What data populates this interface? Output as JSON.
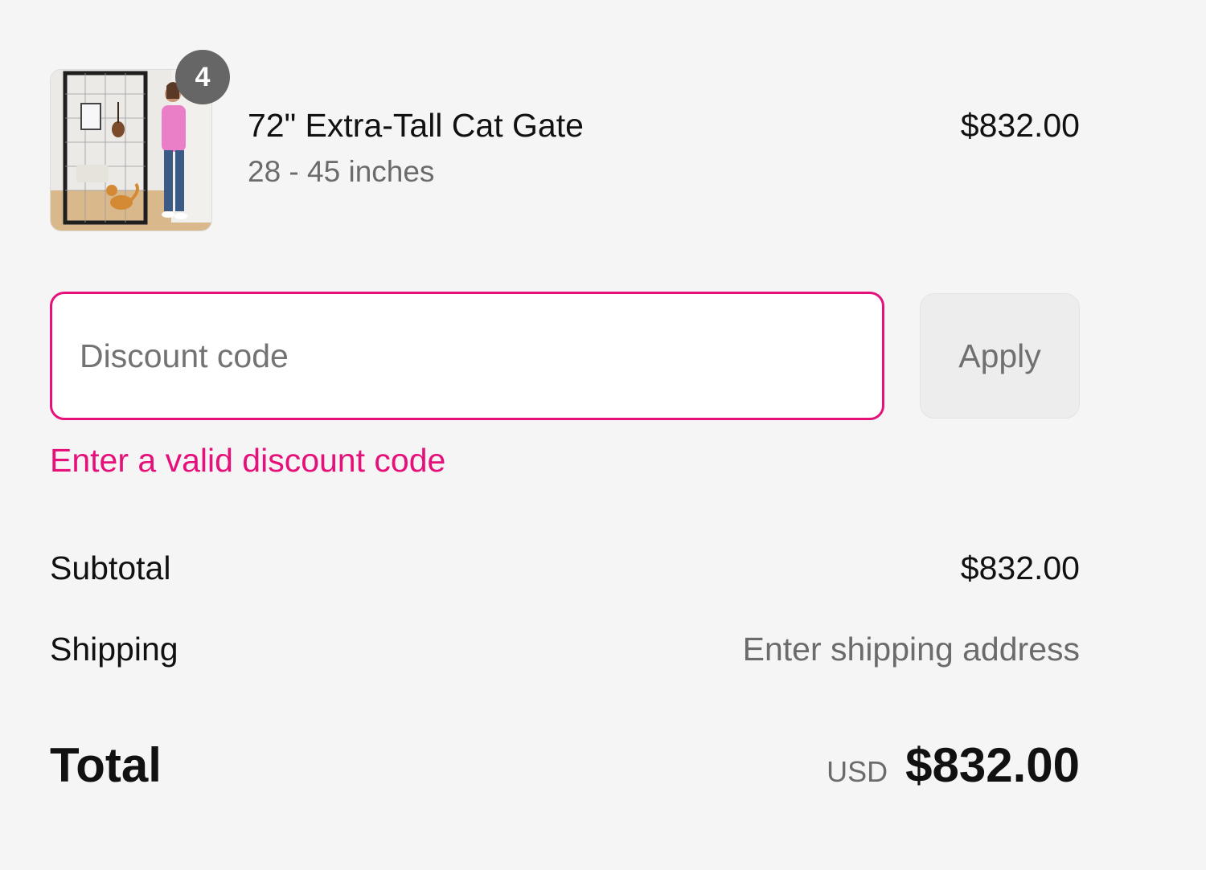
{
  "line_item": {
    "quantity": "4",
    "title": "72\" Extra-Tall Cat Gate",
    "variant": "28 - 45 inches",
    "price": "$832.00"
  },
  "discount": {
    "placeholder": "Discount code",
    "value": "",
    "apply_label": "Apply",
    "error": "Enter a valid discount code"
  },
  "totals": {
    "subtotal_label": "Subtotal",
    "subtotal_value": "$832.00",
    "shipping_label": "Shipping",
    "shipping_value": "Enter shipping address",
    "total_label": "Total",
    "currency": "USD",
    "total_value": "$832.00"
  },
  "colors": {
    "accent_error": "#e5107a",
    "badge": "#666666",
    "background": "#f5f5f5"
  }
}
